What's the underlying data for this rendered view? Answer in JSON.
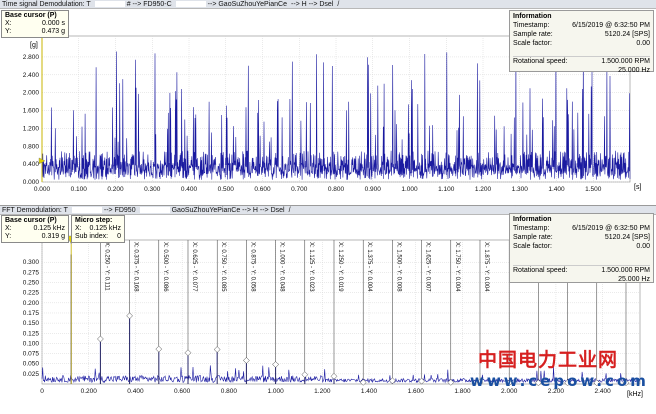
{
  "time_panel": {
    "title": [
      "Time signal Demodulation: T",
      "# --> FD950-C",
      "--> GaoSuZhouYePianCe",
      "--> H --> Dsel",
      "/"
    ],
    "y_unit": "[g]",
    "x_unit": "[s]",
    "cursor": {
      "title": "Base cursor (P)",
      "x_label": "X:",
      "x_value": "0.000 s",
      "y_label": "Y:",
      "y_value": "0.473 g"
    },
    "info": {
      "title": "Information",
      "timestamp_label": "Timestamp:",
      "timestamp": "6/15/2019 @ 6:32:50 PM",
      "rate_label": "Sample rate:",
      "rate": "5120.24 [SPS]",
      "scale_label": "Scale factor:",
      "scale": "0.00",
      "speed_label": "Rotational speed:",
      "speed_rpm": "1.500.000 RPM",
      "speed_hz": "25.000 Hz"
    }
  },
  "fft_panel": {
    "title": [
      "FFT Demodulation: T",
      "--> FD950",
      "GaoSuZhouYePianCe --> H --> Dsel",
      "/"
    ],
    "x_unit": "[kHz]",
    "cursor": {
      "title": "Base cursor (P)",
      "x_label": "X:",
      "x_value": "0.125 kHz",
      "y_label": "Y:",
      "y_value": "0.319 g"
    },
    "micro": {
      "title": "Micro step:",
      "x_label": "X:",
      "x_value": "0.125 kHz",
      "sub_label": "Sub index:",
      "sub_value": "0"
    },
    "info": {
      "title": "Information",
      "timestamp_label": "Timestamp:",
      "timestamp": "6/15/2019 @ 6:32:50 PM",
      "rate_label": "Sample rate:",
      "rate": "5120.24 [SPS]",
      "scale_label": "Scale factor:",
      "scale": "0.00",
      "speed_label": "Rotational speed:",
      "speed_rpm": "1.500.000 RPM",
      "speed_hz": "25.000 Hz"
    }
  },
  "chart_data": [
    {
      "type": "line",
      "x_range": [
        0,
        1.6
      ],
      "ylim": [
        0,
        3.0
      ],
      "x_ticks": [
        "0.000",
        "0.100",
        "0.200",
        "0.300",
        "0.400",
        "0.500",
        "0.600",
        "0.700",
        "0.800",
        "0.900",
        "1.000",
        "1.100",
        "1.200",
        "1.300",
        "1.400",
        "1.500"
      ],
      "y_ticks": [
        "0.000",
        "0.400",
        "0.800",
        "1.200",
        "1.600",
        "2.000",
        "2.400",
        "2.800"
      ],
      "series": [
        {
          "color": "#1a1aa0"
        }
      ],
      "grid": true
    },
    {
      "type": "line",
      "x_range": [
        0,
        2.56
      ],
      "ylim": [
        0,
        0.34
      ],
      "x_ticks": [
        "0",
        "0.200",
        "0.400",
        "0.600",
        "0.800",
        "1.000",
        "1.200",
        "1.400",
        "1.600",
        "1.800",
        "2.000",
        "2.200",
        "2.400"
      ],
      "y_ticks": [
        "0.025",
        "0.050",
        "0.075",
        "0.100",
        "0.125",
        "0.150",
        "0.175",
        "0.200",
        "0.225",
        "0.250",
        "0.275",
        "0.300"
      ],
      "harmonics": [
        {
          "x": 0.125,
          "label": "X: 0.125 - Y: 0.319",
          "y": 0.319
        },
        {
          "x": 0.25,
          "label": "X: 0.250 - Y: 0.111",
          "y": 0.111
        },
        {
          "x": 0.375,
          "label": "X: 0.375 - Y: 0.168",
          "y": 0.168
        },
        {
          "x": 0.5,
          "label": "X: 0.500 - Y: 0.086",
          "y": 0.086
        },
        {
          "x": 0.625,
          "label": "X: 0.625 - Y: 0.077",
          "y": 0.077
        },
        {
          "x": 0.75,
          "label": "X: 0.750 - Y: 0.085",
          "y": 0.085
        },
        {
          "x": 0.875,
          "label": "X: 0.875 - Y: 0.058",
          "y": 0.058
        },
        {
          "x": 1.0,
          "label": "X: 1.000 - Y: 0.048",
          "y": 0.048
        },
        {
          "x": 1.125,
          "label": "X: 1.125 - Y: 0.023",
          "y": 0.023
        },
        {
          "x": 1.25,
          "label": "X: 1.250 - Y: 0.019",
          "y": 0.019
        },
        {
          "x": 1.375,
          "label": "X: 1.375 - Y: 0.004",
          "y": 0.004
        },
        {
          "x": 1.5,
          "label": "X: 1.500 - Y: 0.008",
          "y": 0.008
        },
        {
          "x": 1.625,
          "label": "X: 1.625 - Y: 0.007",
          "y": 0.007
        },
        {
          "x": 1.75,
          "label": "X: 1.750 - Y: 0.004",
          "y": 0.004
        },
        {
          "x": 1.875,
          "label": "X: 1.875 - Y: 0.004",
          "y": 0.004
        },
        {
          "x": 2.0,
          "label": "X: 2.000 -",
          "y": 0.003
        },
        {
          "x": 2.125,
          "label": "X: 2.125 -",
          "y": 0.003
        },
        {
          "x": 2.25,
          "label": "X: 2.250 -",
          "y": 0.003
        },
        {
          "x": 2.375,
          "label": "X: 2.375 -",
          "y": 0.003
        },
        {
          "x": 2.5,
          "label": "X: 2.500 -",
          "y": 0.003
        }
      ],
      "series": [
        {
          "color": "#1a1aa0"
        }
      ],
      "grid": true
    }
  ],
  "watermark": {
    "cn": "中国电力工业网",
    "url": "www.cepow.com"
  }
}
